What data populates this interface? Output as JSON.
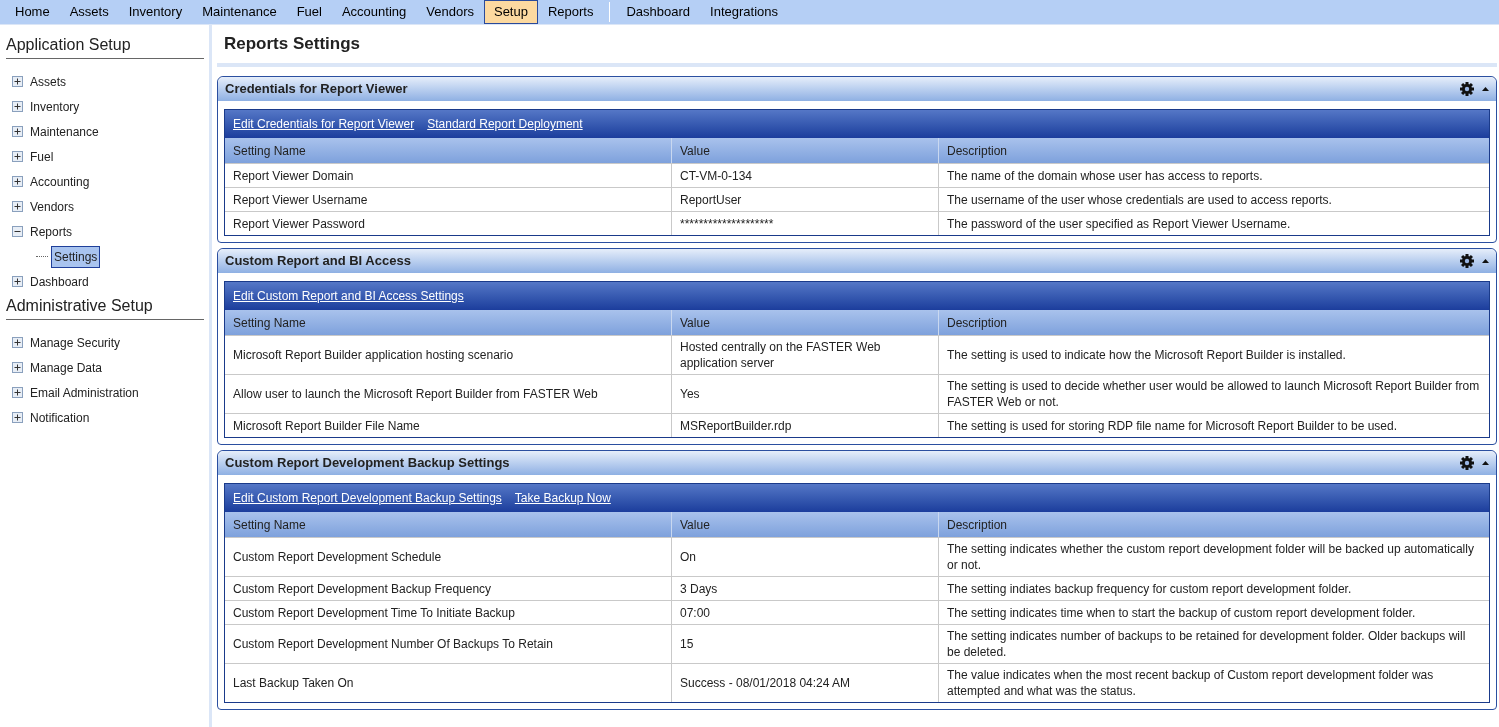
{
  "menu": [
    {
      "label": "Home",
      "selected": false
    },
    {
      "label": "Assets",
      "selected": false
    },
    {
      "label": "Inventory",
      "selected": false
    },
    {
      "label": "Maintenance",
      "selected": false
    },
    {
      "label": "Fuel",
      "selected": false
    },
    {
      "label": "Accounting",
      "selected": false
    },
    {
      "label": "Vendors",
      "selected": false
    },
    {
      "label": "Setup",
      "selected": true
    },
    {
      "label": "Reports",
      "selected": false
    }
  ],
  "menu_secondary": [
    {
      "label": "Dashboard",
      "selected": false
    },
    {
      "label": "Integrations",
      "selected": false
    }
  ],
  "sidebar": {
    "groups": [
      {
        "title": "Application Setup",
        "items": [
          {
            "label": "Assets",
            "expanded": false,
            "selected": false
          },
          {
            "label": "Inventory",
            "expanded": false,
            "selected": false
          },
          {
            "label": "Maintenance",
            "expanded": false,
            "selected": false
          },
          {
            "label": "Fuel",
            "expanded": false,
            "selected": false
          },
          {
            "label": "Accounting",
            "expanded": false,
            "selected": false
          },
          {
            "label": "Vendors",
            "expanded": false,
            "selected": false
          },
          {
            "label": "Reports",
            "expanded": true,
            "selected": false,
            "children": [
              {
                "label": "Settings",
                "selected": true
              }
            ]
          },
          {
            "label": "Dashboard",
            "expanded": false,
            "selected": false
          }
        ]
      },
      {
        "title": "Administrative Setup",
        "items": [
          {
            "label": "Manage Security",
            "expanded": false,
            "selected": false
          },
          {
            "label": "Manage Data",
            "expanded": false,
            "selected": false
          },
          {
            "label": "Email Administration",
            "expanded": false,
            "selected": false
          },
          {
            "label": "Notification",
            "expanded": false,
            "selected": false
          }
        ]
      }
    ]
  },
  "page_title": "Reports Settings",
  "panels": [
    {
      "title": "Credentials for Report Viewer",
      "expanded": true,
      "links": [
        "Edit Credentials for Report Viewer",
        "Standard Report Deployment"
      ],
      "columns": [
        "Setting Name",
        "Value",
        "Description"
      ],
      "rows": [
        [
          "Report Viewer Domain",
          "CT-VM-0-134",
          "The name of the domain whose user has access to reports."
        ],
        [
          "Report Viewer Username",
          "ReportUser",
          "The username of the user whose credentials are used to access reports."
        ],
        [
          "Report Viewer Password",
          "********************",
          "The password of the user specified as Report Viewer Username."
        ]
      ]
    },
    {
      "title": "Custom Report and BI Access",
      "expanded": true,
      "links": [
        "Edit Custom Report and BI Access Settings"
      ],
      "columns": [
        "Setting Name",
        "Value",
        "Description"
      ],
      "rows": [
        [
          "Microsoft Report Builder application hosting scenario",
          "Hosted centrally on the FASTER Web application server",
          "The setting is used to indicate how the Microsoft Report Builder is installed."
        ],
        [
          "Allow user to launch the Microsoft Report Builder from FASTER Web",
          "Yes",
          "The setting is used to decide whether user would be allowed to launch Microsoft Report Builder from FASTER Web or not."
        ],
        [
          "Microsoft Report Builder File Name",
          "MSReportBuilder.rdp",
          "The setting is used for storing RDP file name for Microsoft Report Builder to be used."
        ]
      ]
    },
    {
      "title": "Custom Report Development Backup Settings",
      "expanded": true,
      "links": [
        "Edit Custom Report Development Backup Settings",
        "Take Backup Now"
      ],
      "columns": [
        "Setting Name",
        "Value",
        "Description"
      ],
      "rows": [
        [
          "Custom Report Development Schedule",
          "On",
          "The setting indicates whether the custom report development folder will be backed up automatically or not."
        ],
        [
          "Custom Report Development Backup Frequency",
          "3 Days",
          "The setting indiates backup frequency for custom report development folder."
        ],
        [
          "Custom Report Development Time To Initiate Backup",
          "07:00",
          "The setting indicates time when to start the backup of custom report development folder."
        ],
        [
          "Custom Report Development Number Of Backups To Retain",
          "15",
          "The setting indicates number of backups to be retained for development folder. Older backups will be deleted."
        ],
        [
          "Last Backup Taken On",
          "Success - 08/01/2018 04:24 AM",
          "The value indicates when the most recent backup of Custom report development folder was attempted and what was the status."
        ]
      ]
    }
  ]
}
